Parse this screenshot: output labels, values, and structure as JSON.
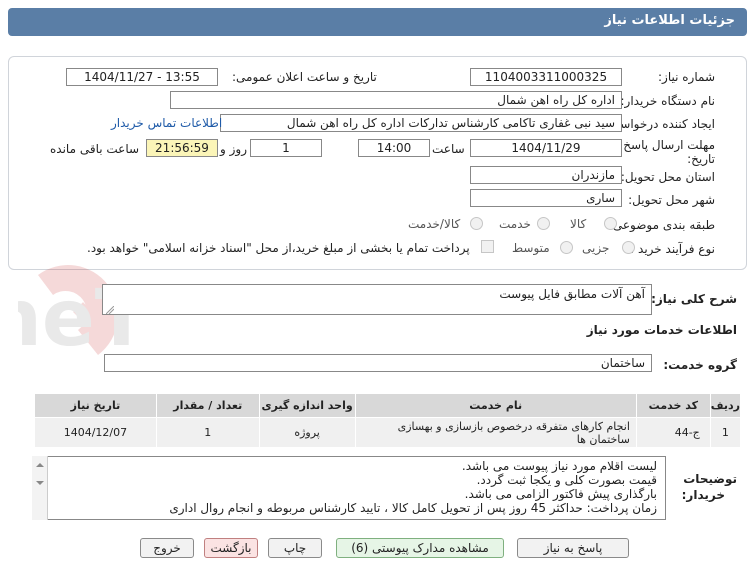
{
  "header": {
    "title": "جزئیات اطلاعات نیاز"
  },
  "form": {
    "need_number_label": "شماره نیاز:",
    "need_number": "1104003311000325",
    "announce_label": "تاریخ و ساعت اعلان عمومی:",
    "announce_value": "1404/11/27 - 13:55",
    "buyer_org_label": "نام دستگاه خریدار:",
    "buyer_org": "اداره کل راه اهن شمال",
    "creator_label": "ایجاد کننده درخواست:",
    "creator": "سید نبی غفاری تاکامی کارشناس تدارکات اداره کل راه اهن شمال",
    "contact_link": "اطلاعات تماس خریدار",
    "deadline_label_1": "مهلت ارسال پاسخ: تا",
    "deadline_label_2": "تاریخ:",
    "deadline_date": "1404/11/29",
    "time_label": "ساعت",
    "deadline_time": "14:00",
    "days_value": "1",
    "days_label": "روز و",
    "remaining_time": "21:56:59",
    "remaining_label": "ساعت باقی مانده",
    "province_label": "استان محل تحویل:",
    "province": "مازندران",
    "city_label": "شهر محل تحویل:",
    "city": "ساری",
    "category_label": "طبقه بندی موضوعی:",
    "category_options": [
      "کالا",
      "خدمت",
      "کالا/خدمت"
    ],
    "purchase_type_label": "نوع فرآیند خرید :",
    "purchase_options": [
      "جزیی",
      "متوسط"
    ],
    "payment_note": "پرداخت تمام یا بخشی از مبلغ خرید،از محل \"اسناد خزانه اسلامی\" خواهد بود."
  },
  "summary": {
    "label": "شرح کلی نیاز:",
    "value": "آهن آلات مطابق فایل پیوست"
  },
  "services": {
    "section_title": "اطلاعات خدمات مورد نیاز",
    "group_label": "گروه خدمت:",
    "group_value": "ساختمان",
    "columns": [
      "ردیف",
      "کد خدمت",
      "نام خدمت",
      "واحد اندازه گیری",
      "تعداد / مقدار",
      "تاریخ نیاز"
    ],
    "rows": [
      {
        "row": "1",
        "code": "ج-44",
        "name": "انجام کارهای متفرقه درخصوص بازسازی و بهسازی ساختمان ها",
        "unit": "پروژه",
        "qty": "1",
        "date": "1404/12/07"
      }
    ]
  },
  "buyer_notes": {
    "label_1": "توضیحات",
    "label_2": "خریدار:",
    "lines": [
      "لیست اقلام مورد نیاز پیوست می باشد.",
      "قیمت بصورت کلی و یکجا ثبت گردد.",
      "بارگذاری پیش فاکتور الزامی می باشد.",
      "زمان پرداخت: حداکثر 45 روز  پس از تحویل کامل کالا ، تایید کارشناس مربوطه و انجام روال اداری"
    ]
  },
  "buttons": {
    "reply": "پاسخ به نیاز",
    "view_docs": "مشاهده مدارک پیوستی (6)",
    "print": "چاپ",
    "back": "بازگشت",
    "exit": "خروج"
  },
  "watermark": {
    "text": "AriaTender.neT"
  },
  "colors": {
    "header": "#5a7ea6",
    "link": "#1e5aa8",
    "remaining_bg": "#fbf5b8"
  }
}
